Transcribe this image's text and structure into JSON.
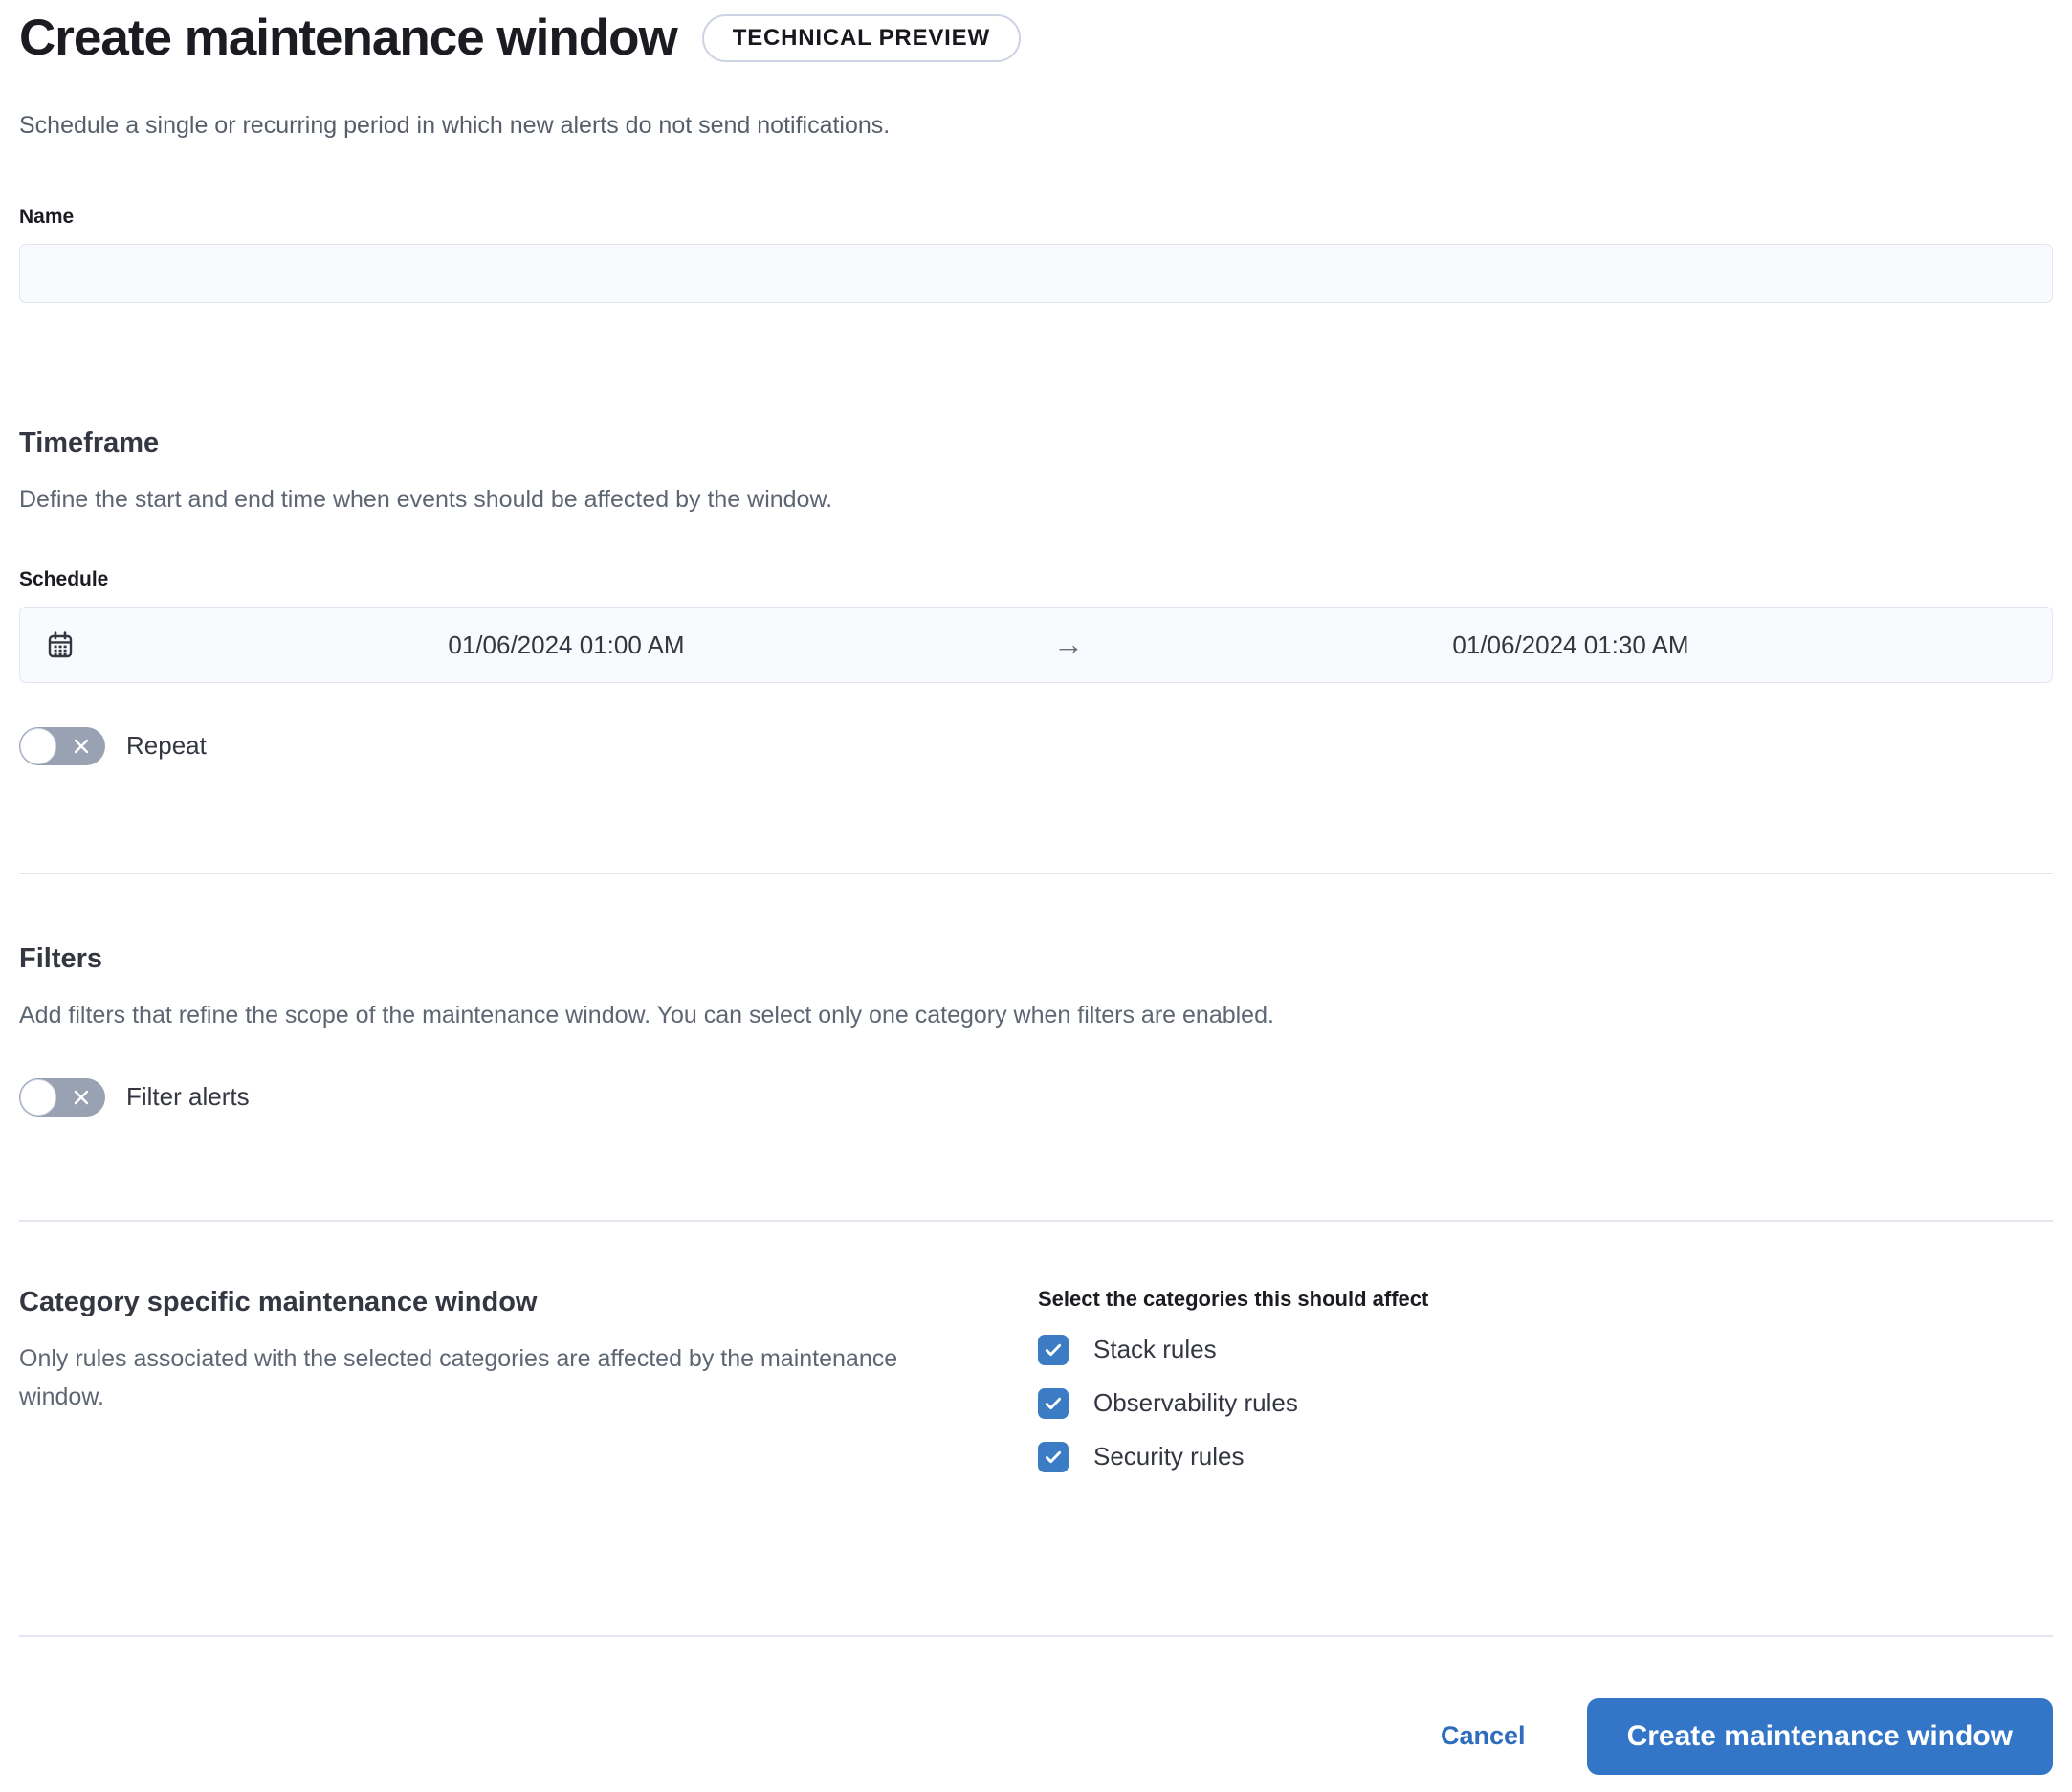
{
  "page": {
    "title": "Create maintenance window",
    "badge": "TECHNICAL PREVIEW",
    "subtitle": "Schedule a single or recurring period in which new alerts do not send notifications."
  },
  "name_field": {
    "label": "Name",
    "value": "",
    "placeholder": ""
  },
  "timeframe": {
    "heading": "Timeframe",
    "description": "Define the start and end time when events should be affected by the window.",
    "schedule_label": "Schedule",
    "start_datetime": "01/06/2024 01:00 AM",
    "end_datetime": "01/06/2024 01:30 AM",
    "arrow": "→",
    "repeat_label": "Repeat",
    "repeat_enabled": false
  },
  "filters": {
    "heading": "Filters",
    "description": "Add filters that refine the scope of the maintenance window. You can select only one category when filters are enabled.",
    "toggle_label": "Filter alerts",
    "filter_enabled": false
  },
  "category": {
    "heading": "Category specific maintenance window",
    "description": "Only rules associated with the selected categories are affected by the maintenance window.",
    "select_label": "Select the categories this should affect",
    "options": [
      {
        "label": "Stack rules",
        "checked": true
      },
      {
        "label": "Observability rules",
        "checked": true
      },
      {
        "label": "Security rules",
        "checked": true
      }
    ]
  },
  "footer": {
    "cancel_label": "Cancel",
    "submit_label": "Create maintenance window"
  },
  "colors": {
    "primary_button_blue": "#3375c7",
    "checkbox_blue": "#3b7cc4",
    "link_blue": "#2e6cbe",
    "toggle_off_gray": "#98a2b3",
    "input_background": "#f8fafd",
    "divider": "#e3e8f0"
  }
}
